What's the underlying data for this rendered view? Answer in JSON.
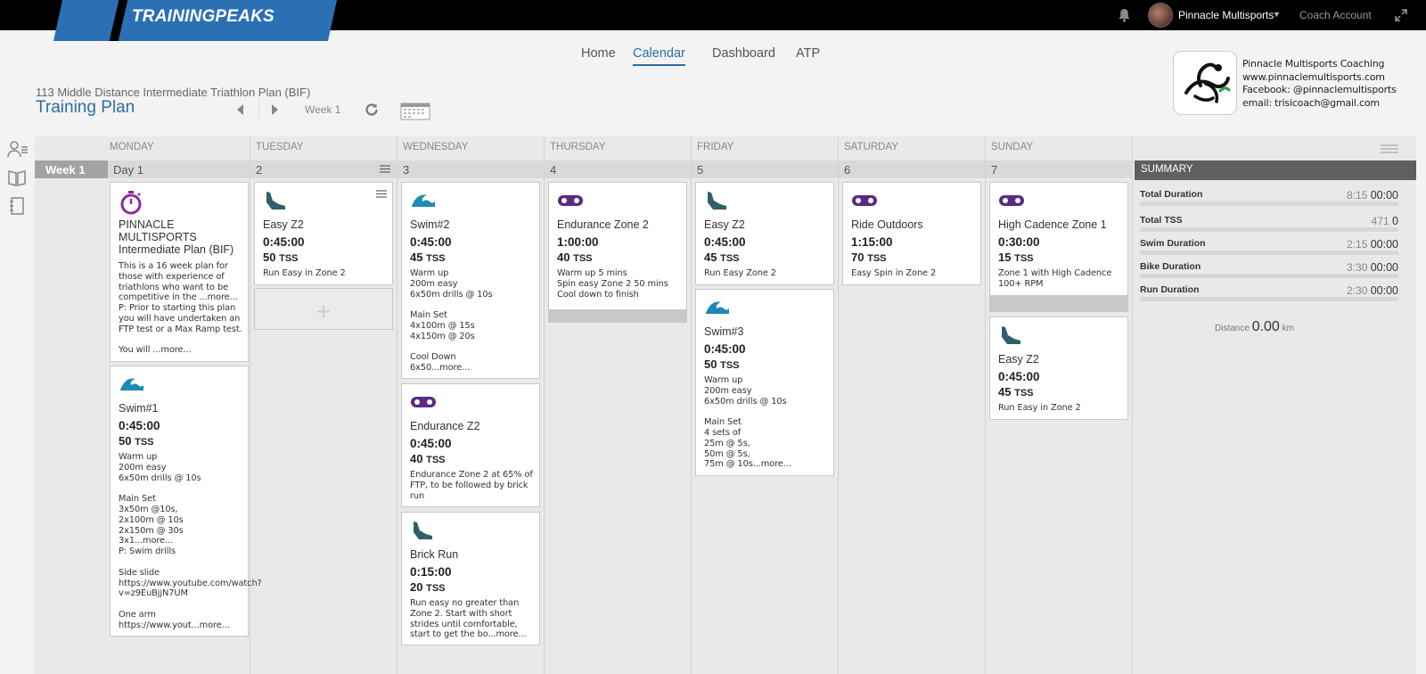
{
  "app": {
    "brand": "TRAININGPEAKS",
    "account_name": "Pinnacle Multisports",
    "account_menu": "Coach Account"
  },
  "nav": {
    "tabs": [
      {
        "label": "Home"
      },
      {
        "label": "Calendar",
        "active": true
      },
      {
        "label": "Dashboard"
      },
      {
        "label": "ATP"
      }
    ]
  },
  "plan": {
    "name": "113 Middle Distance Intermediate Triathlon Plan (BIF)",
    "title": "Training Plan",
    "week_label": "Week 1"
  },
  "coach_brand": {
    "lines": [
      "Pinnacle Multisports Coaching",
      "www.pinnaclemultisports.com",
      "Facebook: @pinnaclemultisports",
      "email: trisicoach@gmail.com"
    ]
  },
  "calendar": {
    "week": "Week 1",
    "days": [
      {
        "name": "MONDAY",
        "date": "Day 1"
      },
      {
        "name": "TUESDAY",
        "date": "2"
      },
      {
        "name": "WEDNESDAY",
        "date": "3"
      },
      {
        "name": "THURSDAY",
        "date": "4"
      },
      {
        "name": "FRIDAY",
        "date": "5"
      },
      {
        "name": "SATURDAY",
        "date": "6"
      },
      {
        "name": "SUNDAY",
        "date": "7"
      }
    ],
    "workouts": {
      "mon_note": {
        "icon": "stopwatch-icon",
        "title": "PINNACLE MULTISPORTS Intermediate Plan (BIF)",
        "desc": "This is a 16 week plan for those with experience of triathlons who want to be competitive in the ...more...\nP: Prior to starting this plan you will have undertaken an FTP test or a Max Ramp test.\n\nYou will ...more..."
      },
      "mon_swim": {
        "icon": "swim-icon",
        "title": "Swim#1",
        "duration": "0:45:00",
        "tss": "50",
        "tss_unit": "TSS",
        "desc": "Warm up\n200m easy\n6x50m drills @ 10s\n\nMain Set\n3x50m @10s,\n2x100m @ 10s\n2x150m @ 30s\n3x1...more...\nP: Swim drills\n\nSide slide\nhttps://www.youtube.com/watch?v=z9EuBjjN7UM\n\nOne arm\nhttps://www.yout...more..."
      },
      "tue_run": {
        "icon": "run-shoe-icon",
        "title": "Easy Z2",
        "duration": "0:45:00",
        "tss": "50",
        "tss_unit": "TSS",
        "desc": "Run Easy in Zone 2"
      },
      "wed_swim": {
        "icon": "swim-icon",
        "title": "Swim#2",
        "duration": "0:45:00",
        "tss": "45",
        "tss_unit": "TSS",
        "desc": "Warm up\n200m easy\n6x50m drills @ 10s\n\nMain Set\n4x100m @ 15s\n4x150m @ 20s\n\nCool Down\n6x50...more..."
      },
      "wed_bike": {
        "icon": "bike-chain-icon",
        "title": "Endurance Z2",
        "duration": "0:45:00",
        "tss": "40",
        "tss_unit": "TSS",
        "desc": "Endurance Zone 2 at 65% of FTP, to be followed by brick run"
      },
      "wed_run": {
        "icon": "run-shoe-icon",
        "title": "Brick Run",
        "duration": "0:15:00",
        "tss": "20",
        "tss_unit": "TSS",
        "desc": "Run easy no greater than Zone 2.  Start with short strides until comfortable, start to get the bo...more..."
      },
      "thu_bike": {
        "icon": "bike-chain-icon",
        "title": "Endurance Zone 2",
        "duration": "1:00:00",
        "tss": "40",
        "tss_unit": "TSS",
        "desc": "Warm up 5 mins\nSpin easy Zone 2 50 mins\nCool down to finish"
      },
      "fri_run": {
        "icon": "run-shoe-icon",
        "title": "Easy Z2",
        "duration": "0:45:00",
        "tss": "45",
        "tss_unit": "TSS",
        "desc": "Run Easy Zone 2"
      },
      "fri_swim": {
        "icon": "swim-icon",
        "title": "Swim#3",
        "duration": "0:45:00",
        "tss": "50",
        "tss_unit": "TSS",
        "desc": "Warm up\n200m easy\n6x50m drills @ 10s\n\nMain Set\n4 sets of\n25m @ 5s,\n50m @ 5s,\n75m @ 10s...more..."
      },
      "sat_bike": {
        "icon": "bike-chain-icon",
        "title": "Ride Outdoors",
        "duration": "1:15:00",
        "tss": "70",
        "tss_unit": "TSS",
        "desc": "Easy Spin in Zone 2"
      },
      "sun_bike": {
        "icon": "bike-chain-icon",
        "title": "High Cadence Zone 1",
        "duration": "0:30:00",
        "tss": "15",
        "tss_unit": "TSS",
        "desc": "Zone 1 with High Cadence 100+ RPM"
      },
      "sun_run": {
        "icon": "run-shoe-icon",
        "title": "Easy Z2",
        "duration": "0:45:00",
        "tss": "45",
        "tss_unit": "TSS",
        "desc": "Run Easy in Zone 2"
      }
    }
  },
  "summary": {
    "title": "SUMMARY",
    "rows": [
      {
        "label": "Total Duration",
        "planned": "8:15",
        "completed": "00:00"
      },
      {
        "label": "Total TSS",
        "planned": "471",
        "completed": "0"
      },
      {
        "label": "Swim Duration",
        "planned": "2:15",
        "completed": "00:00"
      },
      {
        "label": "Bike Duration",
        "planned": "3:30",
        "completed": "00:00"
      },
      {
        "label": "Run Duration",
        "planned": "2:30",
        "completed": "00:00"
      }
    ],
    "distance_label": "Distance",
    "distance_value": "0.00",
    "distance_unit": "km"
  },
  "colors": {
    "accent": "#2b6ea3",
    "swim": "#1b8bb5",
    "bike": "#5a2a84",
    "run": "#2e5f6a",
    "note": "#8e2a9e"
  }
}
